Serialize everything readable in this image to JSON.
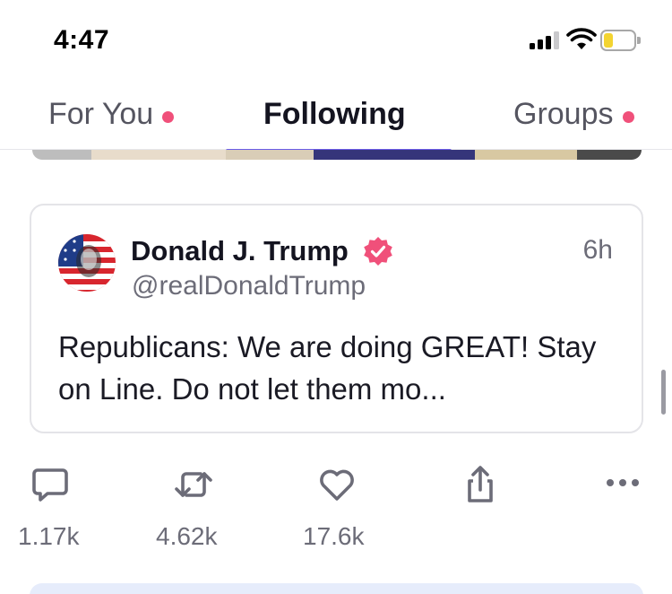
{
  "status_bar": {
    "time": "4:47",
    "icons": [
      "signal-icon",
      "wifi-icon",
      "battery-icon"
    ],
    "battery_color": "#f3d431"
  },
  "tabs": [
    {
      "label": "For You",
      "has_dot": true,
      "active": false
    },
    {
      "label": "Following",
      "has_dot": false,
      "active": true
    },
    {
      "label": "Groups",
      "has_dot": true,
      "active": false
    }
  ],
  "colors": {
    "accent": "#6b5ce7",
    "notification_dot": "#f0507a",
    "verified_badge": "#f0507a",
    "next_card_bg": "#e6ecfb"
  },
  "post": {
    "author_name": "Donald J. Trump",
    "handle": "@realDonaldTrump",
    "time": "6h",
    "text": "Republicans: We are doing GREAT! Stay on Line. Do not let them mo...",
    "verified": true
  },
  "actions": {
    "reply": {
      "icon": "comment-icon",
      "count": "1.17k"
    },
    "repost": {
      "icon": "repost-icon",
      "count": "4.62k"
    },
    "like": {
      "icon": "heart-icon",
      "count": "17.6k"
    },
    "share": {
      "icon": "share-icon"
    },
    "more": {
      "icon": "more-icon"
    }
  }
}
